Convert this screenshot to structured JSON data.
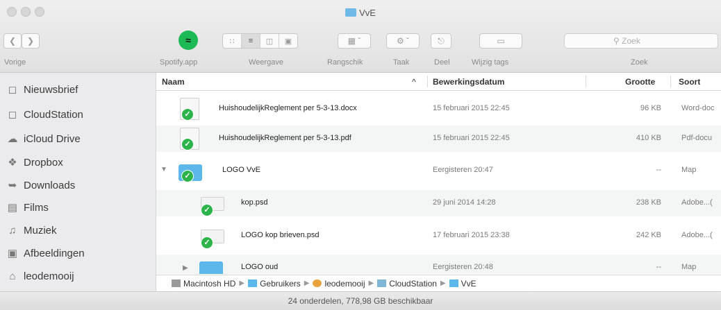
{
  "window": {
    "title": "VvE"
  },
  "toolbar": {
    "back_label": "Vorige",
    "spotify_label": "Spotify.app",
    "view_label": "Weergave",
    "arrange_label": "Rangschik",
    "action_label": "Taak",
    "share_label": "Deel",
    "tags_label": "Wijzig tags",
    "search_label": "Zoek",
    "search_placeholder": "Zoek"
  },
  "sidebar": {
    "items": [
      {
        "label": "Nieuwsbrief",
        "icon": "folder-icon"
      },
      {
        "label": "CloudStation",
        "icon": "folder-icon"
      },
      {
        "label": "iCloud Drive",
        "icon": "cloud-icon"
      },
      {
        "label": "Dropbox",
        "icon": "dropbox-icon"
      },
      {
        "label": "Downloads",
        "icon": "download-icon"
      },
      {
        "label": "Films",
        "icon": "film-icon"
      },
      {
        "label": "Muziek",
        "icon": "music-icon"
      },
      {
        "label": "Afbeeldingen",
        "icon": "camera-icon"
      },
      {
        "label": "leodemooij",
        "icon": "home-icon"
      }
    ]
  },
  "columns": {
    "name": "Naam",
    "date": "Bewerkingsdatum",
    "size": "Grootte",
    "kind": "Soort",
    "sort_arrow": "^"
  },
  "files": [
    {
      "name": "HuishoudelijkReglement per 5-3-13.docx",
      "date": "15 februari 2015 22:45",
      "size": "96 KB",
      "kind": "Word-doc"
    },
    {
      "name": "HuishoudelijkReglement per 5-3-13.pdf",
      "date": "15 februari 2015 22:45",
      "size": "410 KB",
      "kind": "Pdf-docu"
    },
    {
      "name": "LOGO VvE",
      "date": "Eergisteren 20:47",
      "size": "--",
      "kind": "Map"
    },
    {
      "name": "kop.psd",
      "date": "29 juni 2014 14:28",
      "size": "238 KB",
      "kind": "Adobe...("
    },
    {
      "name": "LOGO kop brieven.psd",
      "date": "17 februari 2015 23:38",
      "size": "242 KB",
      "kind": "Adobe...("
    },
    {
      "name": "LOGO oud",
      "date": "Eergisteren 20:48",
      "size": "--",
      "kind": "Map"
    }
  ],
  "pathbar": {
    "items": [
      "Macintosh HD",
      "Gebruikers",
      "leodemooij",
      "CloudStation",
      "VvE"
    ]
  },
  "status": {
    "text": "24 onderdelen, 778,98 GB beschikbaar"
  },
  "colors": {
    "accent": "#5cb8eb",
    "sync_check": "#2cb34a",
    "spotify": "#1db954"
  }
}
